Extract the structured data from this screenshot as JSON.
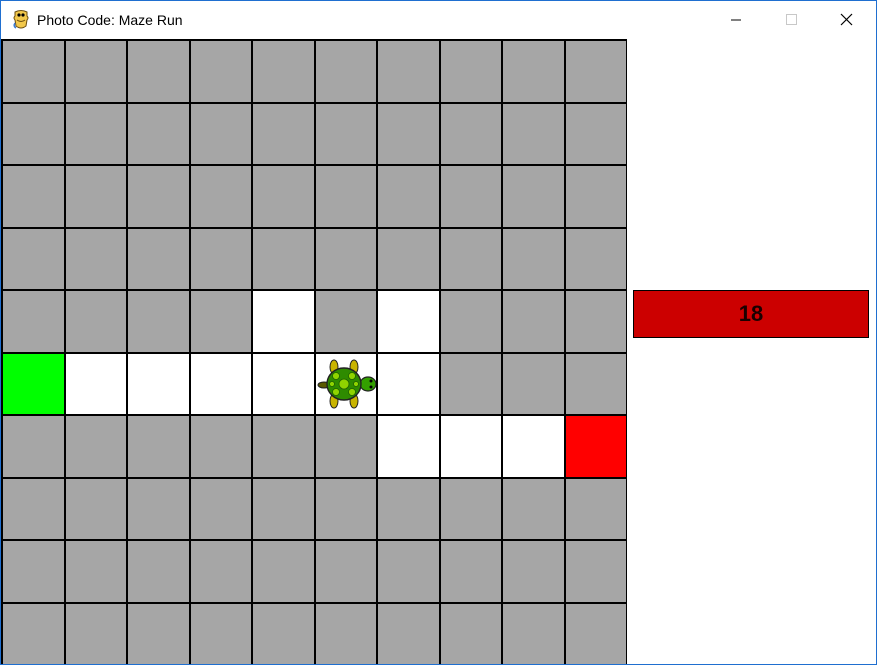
{
  "window": {
    "title": "Photo Code: Maze Run",
    "app_icon": "python-snake-icon",
    "controls": [
      "minimize-icon",
      "maximize-icon",
      "close-icon"
    ]
  },
  "maze": {
    "rows": 10,
    "cols": 10,
    "colors": {
      "wall": "#a6a6a6",
      "path": "#ffffff",
      "start": "#00ff00",
      "goal": "#ff0000",
      "grid_line": "#000000"
    },
    "grid": [
      "WWWWWWWWWW",
      "WWWWWWWWWW",
      "WWWWWWWWWW",
      "WWWWWWWWWW",
      "WWWWPWPWWW",
      "SPPPPPPWWW",
      "WWWWWWPPPG",
      "WWWWWWWWWW",
      "WWWWWWWWWW",
      "WWWWWWWWWW"
    ],
    "turtle": {
      "row": 5,
      "col": 5,
      "facing": "right",
      "icon": "turtle-icon"
    }
  },
  "counter": {
    "value": "18",
    "background": "#cc0000"
  }
}
